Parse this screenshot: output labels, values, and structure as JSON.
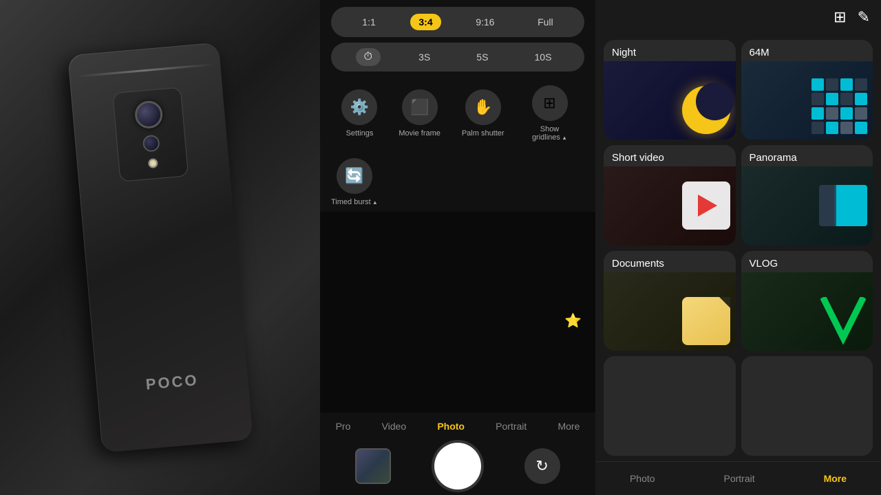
{
  "left": {
    "phone_brand": "POCO"
  },
  "middle": {
    "aspect_ratios": [
      {
        "label": "1:1",
        "active": false
      },
      {
        "label": "3:4",
        "active": true
      },
      {
        "label": "9:16",
        "active": false
      },
      {
        "label": "Full",
        "active": false
      }
    ],
    "timers": [
      {
        "label": "",
        "icon": "⏱",
        "active": true
      },
      {
        "label": "3S",
        "active": false
      },
      {
        "label": "5S",
        "active": false
      },
      {
        "label": "10S",
        "active": false
      }
    ],
    "controls": [
      {
        "icon": "⚙",
        "label": "Settings"
      },
      {
        "icon": "⬛",
        "label": "Movie frame"
      },
      {
        "icon": "✋",
        "label": "Palm shutter"
      },
      {
        "icon": "⊞",
        "label": "Show gridlines",
        "has_arrow": true
      }
    ],
    "controls2": [
      {
        "icon": "🔄",
        "label": "Timed burst",
        "has_arrow": true
      }
    ],
    "modes": [
      "Pro",
      "Video",
      "Photo",
      "Portrait",
      "More"
    ],
    "active_mode": "Photo"
  },
  "right": {
    "header_icons": [
      "grid-icon",
      "edit-icon"
    ],
    "mode_cards": [
      {
        "id": "night",
        "title": "Night"
      },
      {
        "id": "64m",
        "title": "64M"
      },
      {
        "id": "short-video",
        "title": "Short video"
      },
      {
        "id": "panorama",
        "title": "Panorama"
      },
      {
        "id": "documents",
        "title": "Documents"
      },
      {
        "id": "vlog",
        "title": "VLOG"
      },
      {
        "id": "partial1",
        "title": ""
      },
      {
        "id": "partial2",
        "title": ""
      }
    ],
    "bottom_tabs": [
      "Photo",
      "Portrait",
      "More"
    ],
    "active_tab": "More"
  }
}
